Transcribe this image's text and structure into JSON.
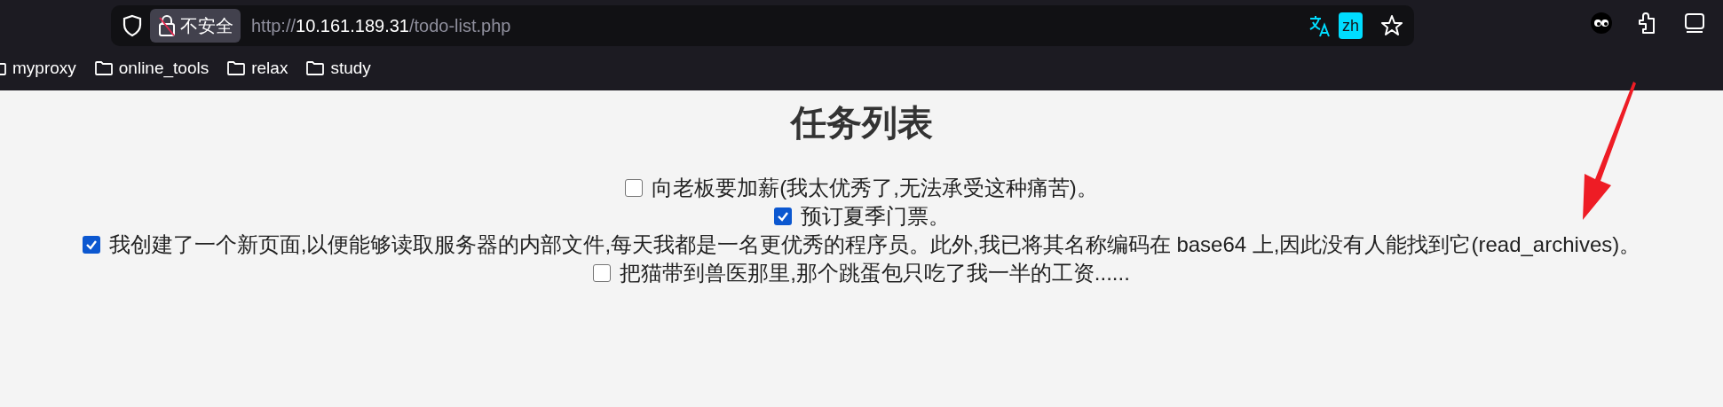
{
  "browser": {
    "security_label": "不安全",
    "url_scheme": "http://",
    "url_host": "10.161.189.31",
    "url_path": "/todo-list.php",
    "translate_badge": "zh",
    "bookmarks": [
      "myproxy",
      "online_tools",
      "relax",
      "study"
    ]
  },
  "page": {
    "title": "任务列表",
    "tasks": [
      {
        "text": "向老板要加薪(我太优秀了,无法承受这种痛苦)。",
        "checked": false
      },
      {
        "text": "预订夏季门票。",
        "checked": true
      },
      {
        "text": "我创建了一个新页面,以便能够读取服务器的内部文件,每天我都是一名更优秀的程序员。此外,我已将其名称编码在 base64 上,因此没有人能找到它(read_archives)。",
        "checked": true
      },
      {
        "text": "把猫带到兽医那里,那个跳蛋包只吃了我一半的工资......",
        "checked": false
      }
    ]
  }
}
